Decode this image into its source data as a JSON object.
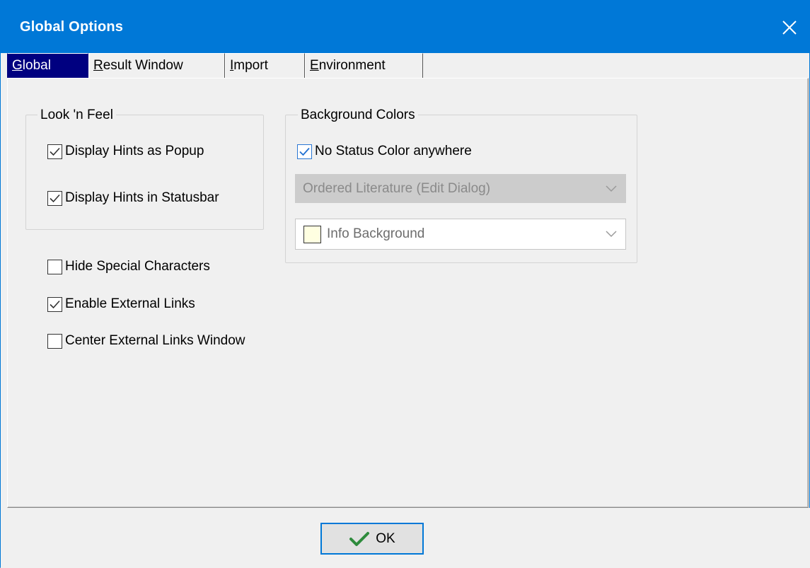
{
  "window": {
    "title": "Global Options"
  },
  "tabs": [
    {
      "label": "Global",
      "mnemonic": "G",
      "rest": "lobal",
      "active": true
    },
    {
      "label": "Result Window",
      "mnemonic": "R",
      "rest": "esult Window",
      "active": false
    },
    {
      "label": "Import",
      "mnemonic": "I",
      "rest": "mport",
      "active": false
    },
    {
      "label": "Environment",
      "mnemonic": "E",
      "rest": "nvironment",
      "active": false
    }
  ],
  "look_n_feel": {
    "title": "Look 'n Feel",
    "display_hints_popup": {
      "label": "Display Hints as Popup",
      "checked": true
    },
    "display_hints_statusbar": {
      "label": "Display Hints in Statusbar",
      "checked": true
    }
  },
  "options": {
    "hide_special_characters": {
      "label": "Hide Special Characters",
      "checked": false
    },
    "enable_external_links": {
      "label": "Enable External Links",
      "checked": true
    },
    "center_external_links_window": {
      "label": "Center External Links Window",
      "checked": false
    }
  },
  "background_colors": {
    "title": "Background Colors",
    "no_status_color": {
      "label": "No Status Color anywhere",
      "checked": true
    },
    "target_select": {
      "value": "Ordered Literature (Edit Dialog)",
      "disabled": true
    },
    "color_select": {
      "value": "Info Background",
      "swatch_color": "#ffffe1"
    }
  },
  "footer": {
    "ok_label": "OK"
  },
  "colors": {
    "titlebar": "#0078d7",
    "active_tab": "#000080",
    "check_mark": "#333333",
    "ok_check": "#2e8b3c"
  }
}
